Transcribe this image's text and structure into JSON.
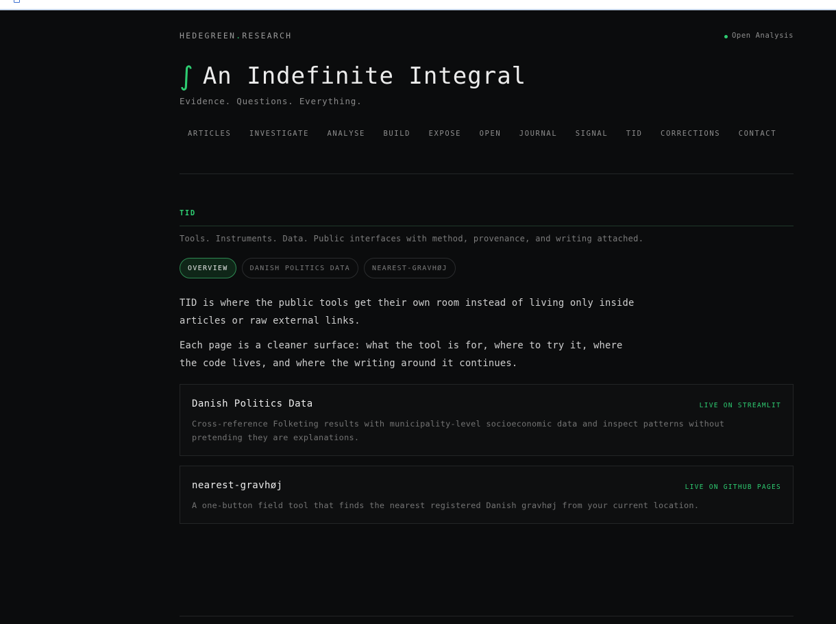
{
  "site": {
    "brand_prefix": "HEDEGREEN",
    "brand_dot": ".",
    "brand_suffix": "RESEARCH",
    "status": "Open Analysis",
    "integral_symbol": "∫",
    "title": "An Indefinite Integral",
    "tagline": "Evidence. Questions. Everything."
  },
  "nav": {
    "items": [
      {
        "label": "ARTICLES"
      },
      {
        "label": "INVESTIGATE"
      },
      {
        "label": "ANALYSE"
      },
      {
        "label": "BUILD"
      },
      {
        "label": "EXPOSE"
      },
      {
        "label": "OPEN"
      },
      {
        "label": "JOURNAL"
      },
      {
        "label": "SIGNAL"
      },
      {
        "label": "TID"
      },
      {
        "label": "CORRECTIONS"
      },
      {
        "label": "CONTACT"
      }
    ]
  },
  "section": {
    "label": "TID",
    "description": "Tools. Instruments. Data. Public interfaces with method, provenance, and writing attached."
  },
  "tabs": [
    {
      "label": "OVERVIEW",
      "active": true
    },
    {
      "label": "DANISH POLITICS DATA",
      "active": false
    },
    {
      "label": "NEAREST-GRAVHØJ",
      "active": false
    }
  ],
  "intro": {
    "p1": "TID is where the public tools get their own room instead of living only inside articles or raw external links.",
    "p2": "Each page is a cleaner surface: what the tool is for, where to try it, where the code lives, and where the writing around it continues."
  },
  "tools": [
    {
      "title": "Danish Politics Data",
      "badge": "LIVE ON STREAMLIT",
      "description": "Cross-reference Folketing results with municipality-level socioeconomic data and inspect patterns without pretending they are explanations."
    },
    {
      "title": "nearest-gravhøj",
      "badge": "LIVE ON GITHUB PAGES",
      "description": "A one-button field tool that finds the nearest registered Danish gravhøj from your current location."
    }
  ],
  "colors": {
    "accent": "#2ecc71",
    "background": "#0b0c0d"
  }
}
